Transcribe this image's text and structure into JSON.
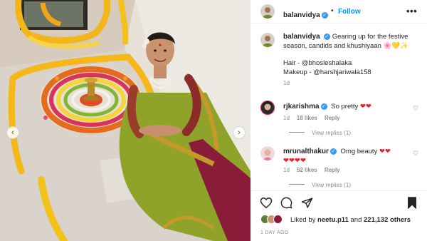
{
  "post": {
    "username": "balanvidya",
    "follow_label": "Follow",
    "more_label": "•••",
    "separator": "•",
    "verified_mark": "✓"
  },
  "caption": {
    "username": "balanvidya",
    "text": "Gearing up for the festive season, candids and khushiyaan",
    "emojis": "🌸💛✨",
    "hair": "Hair - @bhosleshalaka",
    "makeup": "Makeup - @harshjariwala158",
    "time": "1d"
  },
  "comments": [
    {
      "username": "rjkarishma",
      "text": "So pretty",
      "hearts": "❤❤",
      "time": "1d",
      "likes": "18 likes",
      "reply": "Reply",
      "view_replies": "View replies (1)"
    },
    {
      "username": "mrunalthakur",
      "text": "Omg beauty",
      "hearts": "❤❤",
      "hearts2": "❤❤❤❤",
      "time": "1d",
      "likes": "52 likes",
      "reply": "Reply",
      "view_replies": "View replies (1)"
    }
  ],
  "likes": {
    "prefix": "Liked by",
    "user": "neetu.p11",
    "and": "and",
    "count": "221,132 others"
  },
  "timestamp": "1 DAY AGO",
  "nav": {
    "prev": "‹",
    "next": "›"
  },
  "colors": {
    "accent": "#0095f6",
    "verified": "#3897f0",
    "heart": "#ed1c2e",
    "saree_green": "#8fa22a",
    "saree_maroon": "#8a1c3a"
  },
  "icons": [
    "heart-icon",
    "comment-icon",
    "share-icon",
    "bookmark-icon",
    "more-icon",
    "verified-icon"
  ]
}
